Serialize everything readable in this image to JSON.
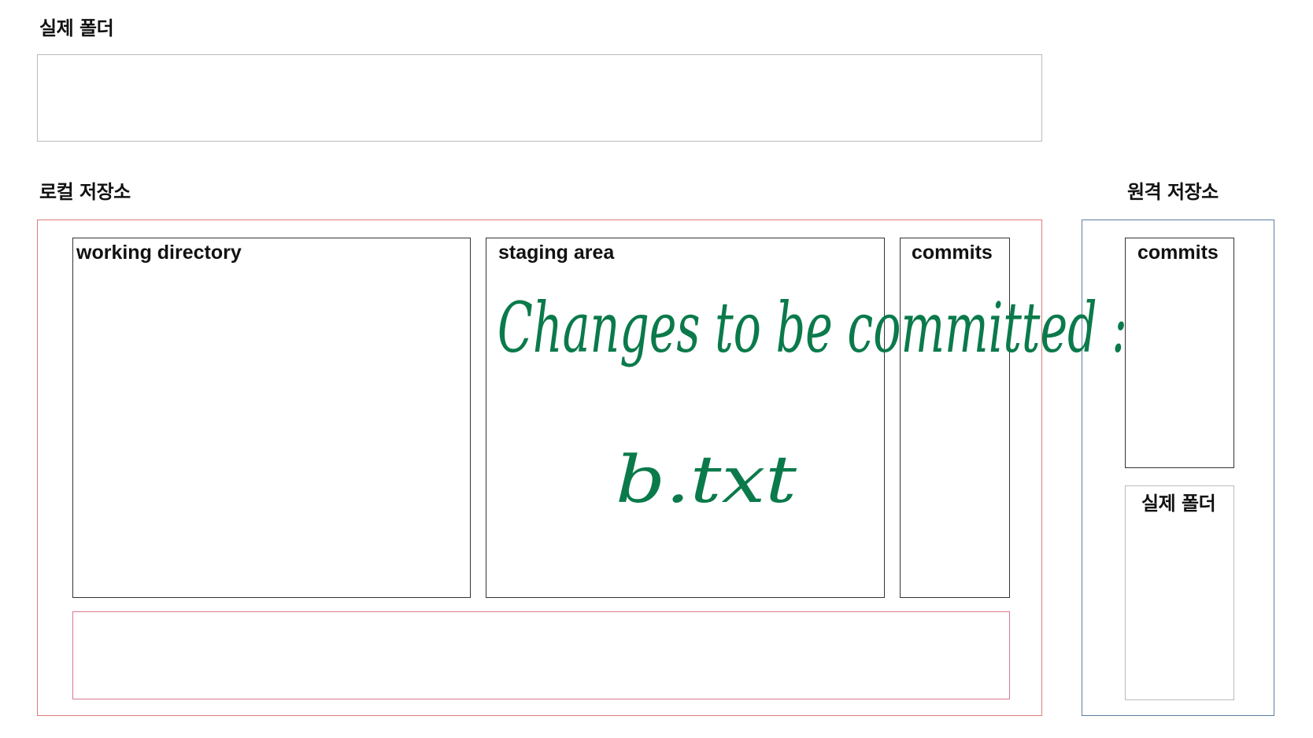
{
  "sections": {
    "real_folder_top": {
      "title": "실제 폴더"
    },
    "local_repo": {
      "title": "로컬 저장소",
      "working_directory": "working directory",
      "staging_area": "staging area",
      "commits": "commits"
    },
    "remote_repo": {
      "title": "원격 저장소",
      "commits": "commits",
      "real_folder": "실제 폴더"
    }
  },
  "annotation": {
    "line1": "Changes to be committed :",
    "line2": "b.txt",
    "color": "#0b7a4b"
  },
  "colors": {
    "local_border": "#e07a7a",
    "inner_pink_border": "#d9798f",
    "remote_border": "#5b7fa3",
    "top_folder_border": "#bbbbbb",
    "inner_box_border": "#333333"
  }
}
